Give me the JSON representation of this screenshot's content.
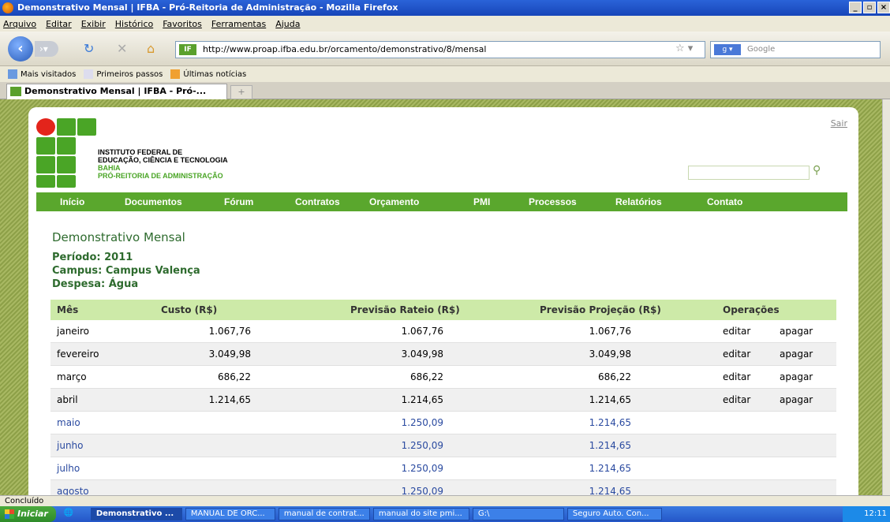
{
  "window": {
    "title": "Demonstrativo Mensal | IFBA - Pró-Reitoria de Administração - Mozilla Firefox"
  },
  "menubar": [
    "Arquivo",
    "Editar",
    "Exibir",
    "Histórico",
    "Favoritos",
    "Ferramentas",
    "Ajuda"
  ],
  "browser": {
    "url": "http://www.proap.ifba.edu.br/orcamento/demonstrativo/8/mensal",
    "search_placeholder": "Google",
    "favicon_text": "IF"
  },
  "bookmarks": [
    "Mais visitados",
    "Primeiros passos",
    "Últimas notícias"
  ],
  "tab": {
    "title": "Demonstrativo Mensal | IFBA - Pró-..."
  },
  "site": {
    "sair": "Sair",
    "institution": [
      "INSTITUTO FEDERAL DE",
      "EDUCAÇÃO, CIÊNCIA E TECNOLOGIA"
    ],
    "state": "BAHIA",
    "dept": "PRÓ-REITORIA DE ADMINISTRAÇÃO",
    "nav": [
      "Início",
      "Documentos",
      "Fórum",
      "Contratos",
      "Orçamento",
      "PMI",
      "Processos",
      "Relatórios",
      "Contato"
    ]
  },
  "main": {
    "title": "Demonstrativo Mensal",
    "periodo": "Período: 2011",
    "campus": "Campus: Campus Valença",
    "despesa": "Despesa: Água"
  },
  "table": {
    "headers": [
      "Mês",
      "Custo (R$)",
      "Previsão Rateio (R$)",
      "Previsão Projeção (R$)",
      "Operações"
    ],
    "edit_label": "editar",
    "delete_label": "apagar",
    "rows": [
      {
        "mes": "janeiro",
        "custo": "1.067,76",
        "rateio": "1.067,76",
        "projecao": "1.067,76",
        "ops": true
      },
      {
        "mes": "fevereiro",
        "custo": "3.049,98",
        "rateio": "3.049,98",
        "projecao": "3.049,98",
        "ops": true
      },
      {
        "mes": "março",
        "custo": "686,22",
        "rateio": "686,22",
        "projecao": "686,22",
        "ops": true
      },
      {
        "mes": "abril",
        "custo": "1.214,65",
        "rateio": "1.214,65",
        "projecao": "1.214,65",
        "ops": true
      },
      {
        "mes": "maio",
        "custo": "",
        "rateio": "1.250,09",
        "projecao": "1.214,65",
        "ops": false
      },
      {
        "mes": "junho",
        "custo": "",
        "rateio": "1.250,09",
        "projecao": "1.214,65",
        "ops": false
      },
      {
        "mes": "julho",
        "custo": "",
        "rateio": "1.250,09",
        "projecao": "1.214,65",
        "ops": false
      },
      {
        "mes": "agosto",
        "custo": "",
        "rateio": "1.250,09",
        "projecao": "1.214,65",
        "ops": false
      }
    ]
  },
  "status": "Concluído",
  "taskbar": {
    "start": "Iniciar",
    "items": [
      "Demonstrativo ...",
      "MANUAL DE ORC...",
      "manual de contrat...",
      "manual do site pmi...",
      "G:\\",
      "Seguro Auto. Con..."
    ],
    "clock": "12:11"
  }
}
